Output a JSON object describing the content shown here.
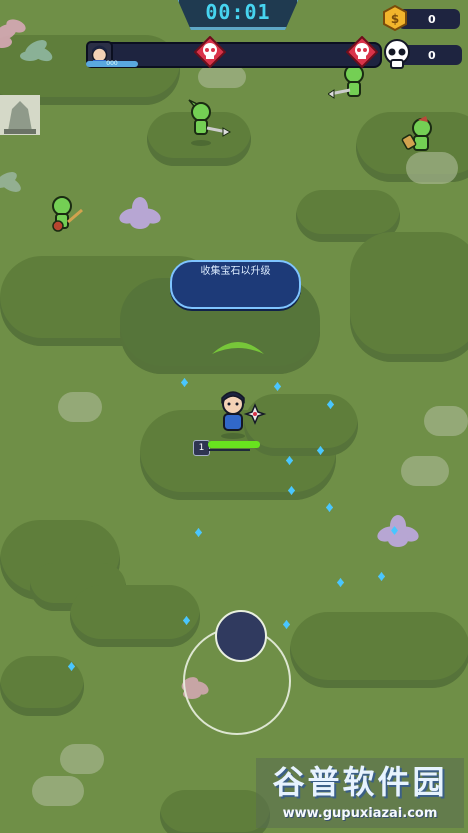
{
  "hud": {
    "timer": "00:01",
    "coins": "0",
    "kills": "0",
    "player_avatar": "hero-face-icon",
    "player_level_label": "000",
    "boss_markers": [
      "boss-skull-icon",
      "boss-skull-icon"
    ]
  },
  "hint": {
    "text": "收集宝石以升级"
  },
  "player": {
    "level": "1",
    "hp_fraction": 1.0,
    "xp_fraction": 0.0
  },
  "watermark": {
    "logo": "谷普软件园",
    "url": "www.gupuxiazai.com"
  },
  "colors": {
    "grass": "#6f8f47",
    "bush": "#5f7e3b",
    "hud_dark": "#1e2440",
    "timer": "#47d4f0",
    "boss_red": "#d9344a",
    "hp_green": "#68e31e",
    "gem_blue": "#49c6ff",
    "hint_bg": "#1d3a78"
  },
  "icons": {
    "coin": "coin-icon",
    "kills": "skull-icon",
    "enemy": "goblin-icon",
    "gem": "gem-icon",
    "weapon": "shuriken-icon"
  }
}
